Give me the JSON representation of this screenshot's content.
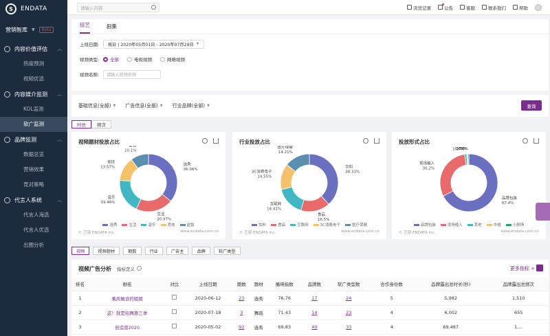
{
  "brand": {
    "logo_text": "ENDATA",
    "product": "营销智库",
    "beta": "Beta"
  },
  "sidebar": {
    "groups": [
      {
        "label": "内容价值评估",
        "items": [
          "热度预测",
          "视频优选"
        ]
      },
      {
        "label": "内容媒介监测",
        "items": [
          "KOL监测",
          "软广监测"
        ]
      },
      {
        "label": "品牌监测",
        "items": [
          "数据总览",
          "营销效果",
          "竞对策略"
        ]
      },
      {
        "label": "代言人系统",
        "items": [
          "代言人海选",
          "代言人优选",
          "出圈分析"
        ]
      }
    ],
    "active_item": "软广监测"
  },
  "topbar": {
    "search_placeholder": "请输入内容",
    "items": [
      "浏览记录",
      "公告",
      "客服",
      "联系我们",
      "帮助"
    ]
  },
  "filter": {
    "tabs": [
      "综艺",
      "剧集"
    ],
    "active_tab": "综艺",
    "date_label": "上线日期:",
    "date_value": "按日 | 2020年05月01日 - 2020年07月29日",
    "type_label": "视频类型:",
    "type_options": [
      "全部",
      "电视视频",
      "网络视频"
    ],
    "name_label": "视频名称:",
    "name_placeholder": "请输入视频名称"
  },
  "dims": {
    "items": [
      "基础信息(全部)",
      "广告信息(全部)",
      "行业品牌(全部)"
    ],
    "query": "查询"
  },
  "toggle": [
    "时长",
    "频次"
  ],
  "charts": {
    "unit": "单位：百分比",
    "source": "© 艺恩 ENDATA Inc.",
    "site": "www.endata.com.cn",
    "chart1": {
      "title": "视频题材投放占比"
    },
    "chart2": {
      "title": "行业投放占比"
    },
    "chart3": {
      "title": "投放形式占比"
    }
  },
  "chart_data": [
    {
      "type": "pie",
      "title": "视频题材投放占比",
      "labels": [
        "选秀",
        "生活",
        "音乐",
        "竞技",
        "益智"
      ],
      "values": [
        36.06,
        20.97,
        19.46,
        13.57,
        10.1
      ],
      "slice_labels": [
        "选秀",
        "生活",
        "音乐",
        "竞技",
        "益智"
      ],
      "slice_values": [
        "36.06%",
        "20.97%",
        "19.46%",
        "13.57%",
        "10.1%"
      ],
      "colors": [
        "#6a6fbf",
        "#e86a6a",
        "#3fb8c4",
        "#f5c26b",
        "#5a8fb0"
      ]
    },
    {
      "type": "pie",
      "title": "行业投放占比",
      "labels": [
        "饮料",
        "食品",
        "互联网",
        "3C消费电子",
        "医疗保健"
      ],
      "values": [
        38.33,
        16.5,
        16.41,
        14.55,
        14.21
      ],
      "slice_labels": [
        "饮料",
        "食品",
        "互联网",
        "3C消费电子",
        "医疗保健"
      ],
      "slice_values": [
        "38.33%",
        "16.5%",
        "16.41%",
        "14.55%",
        "14.21%"
      ],
      "colors": [
        "#6a6fbf",
        "#e86a6a",
        "#3fb8c4",
        "#f5c26b",
        "#5a8fb0"
      ]
    },
    {
      "type": "pie",
      "title": "投放形式占比",
      "labels": [
        "品牌包装",
        "现场植入",
        "其他",
        "中插",
        "小剧场"
      ],
      "values": [
        67.4,
        30.2,
        1.17,
        0.65,
        0.58
      ],
      "slice_labels": [
        "品牌包装",
        "现场植入",
        "其他",
        "中插",
        "小剧场"
      ],
      "slice_values": [
        "67.4%",
        "30.2%",
        "1.17%",
        "0.65%",
        "0.58%"
      ],
      "colors": [
        "#6a6fbf",
        "#e86a6a",
        "#3fb8c4",
        "#f5c26b",
        "#2f9e6a"
      ]
    }
  ],
  "tags": [
    "视频",
    "视频题材",
    "期数",
    "行业",
    "广告主",
    "品牌",
    "软广类型"
  ],
  "table": {
    "title": "视频广告分析",
    "metric": "指标定义",
    "more": "更多指标",
    "headers": [
      "排名",
      "剧名",
      "对比",
      "上线日期",
      "期数",
      "题材",
      "播映指数",
      "品牌数",
      "软广类型数",
      "合作身份数",
      "品牌露出总时长(秒)",
      "品牌露出总频次"
    ],
    "rows": [
      [
        "1",
        "乘风破浪的姐姐",
        "",
        "2020-06-12",
        "23",
        "选秀",
        "76.76",
        "17",
        "24",
        "5",
        "5,982",
        "1,510"
      ],
      [
        "2",
        "这！就是街舞第三季",
        "",
        "2020-07-18",
        "3",
        "舞蹈",
        "71.43",
        "14",
        "23",
        "4",
        "6,002",
        "655"
      ],
      [
        "3",
        "创造营2020",
        "",
        "2020-05-02",
        "92",
        "选秀",
        "69.83",
        "40",
        "33",
        "4",
        "69,487",
        "1,..."
      ]
    ]
  }
}
